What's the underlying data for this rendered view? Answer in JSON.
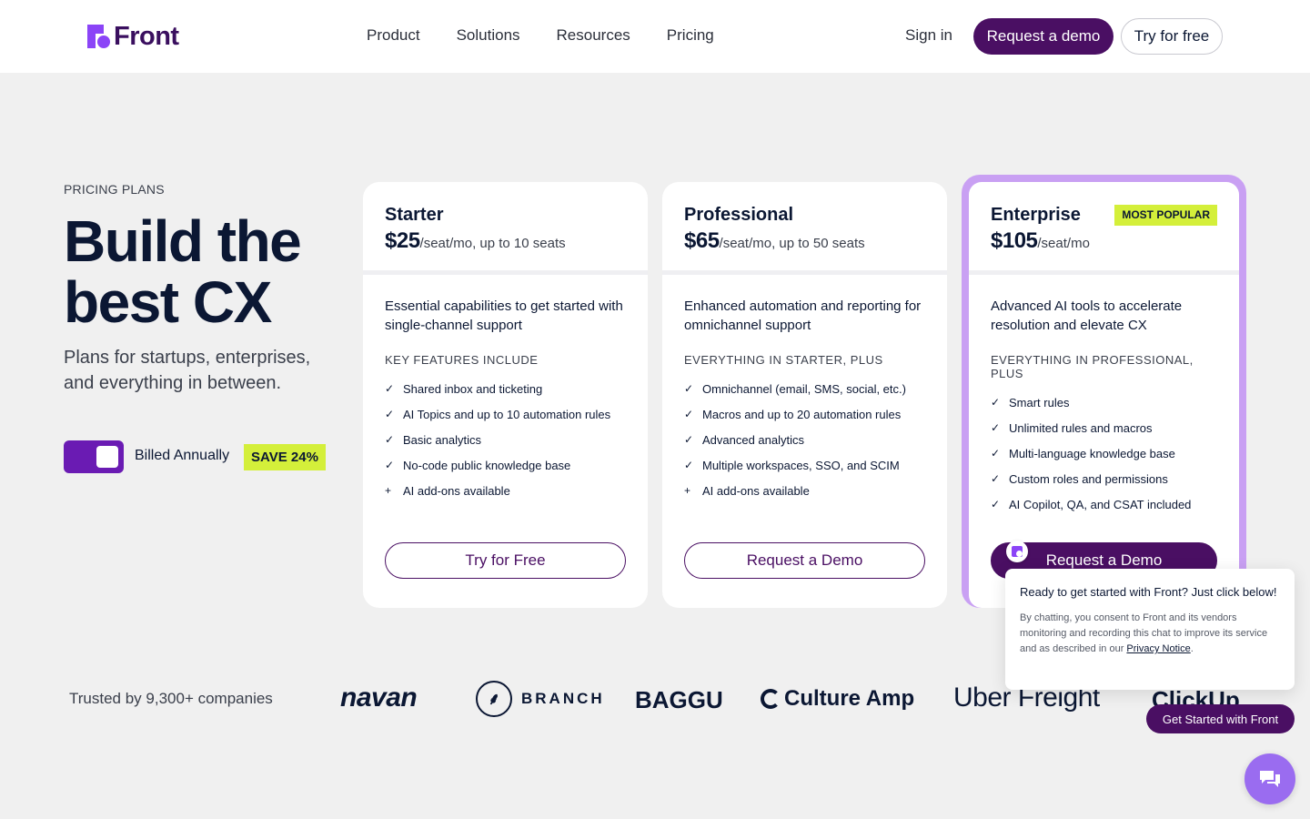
{
  "nav": {
    "logo_text": "Front",
    "links": [
      "Product",
      "Solutions",
      "Resources",
      "Pricing"
    ],
    "signin": "Sign in",
    "request_demo": "Request a demo",
    "try_free": "Try for free"
  },
  "hero": {
    "eyebrow": "PRICING PLANS",
    "headline": "Build the best CX",
    "subhead": "Plans for startups, enterprises, and everything in between.",
    "billing_label": "Billed Annually",
    "save_badge": "SAVE 24%",
    "billed_annually_on": true
  },
  "plans": [
    {
      "name": "Starter",
      "price": "$25",
      "unit": "/seat/mo, up to 10 seats",
      "badge": "",
      "description": "Essential capabilities to get started with single-channel support",
      "features_heading": "KEY FEATURES INCLUDE",
      "features": [
        {
          "icon": "check-icon",
          "text": "Shared inbox and ticketing"
        },
        {
          "icon": "check-icon",
          "text": "AI Topics and up to 10 automation rules"
        },
        {
          "icon": "check-icon",
          "text": "Basic analytics"
        },
        {
          "icon": "check-icon",
          "text": "No-code public knowledge base"
        },
        {
          "icon": "plus-icon",
          "text": "AI add-ons available"
        }
      ],
      "cta": "Try for Free"
    },
    {
      "name": "Professional",
      "price": "$65",
      "unit": "/seat/mo, up to 50 seats",
      "badge": "",
      "description": "Enhanced automation and reporting for omnichannel support",
      "features_heading": "EVERYTHING IN STARTER, PLUS",
      "features": [
        {
          "icon": "check-icon",
          "text": "Omnichannel (email, SMS, social, etc.)"
        },
        {
          "icon": "check-icon",
          "text": "Macros and up to 20 automation rules"
        },
        {
          "icon": "check-icon",
          "text": "Advanced analytics"
        },
        {
          "icon": "check-icon",
          "text": "Multiple workspaces, SSO, and SCIM"
        },
        {
          "icon": "plus-icon",
          "text": "AI add-ons available"
        }
      ],
      "cta": "Request a Demo"
    },
    {
      "name": "Enterprise",
      "price": "$105",
      "unit": "/seat/mo",
      "badge": "MOST POPULAR",
      "description": "Advanced AI tools to accelerate resolution and elevate CX",
      "features_heading": "EVERYTHING IN PROFESSIONAL, PLUS",
      "features": [
        {
          "icon": "check-icon",
          "text": "Smart rules"
        },
        {
          "icon": "check-icon",
          "text": "Unlimited rules and macros"
        },
        {
          "icon": "check-icon",
          "text": "Multi-language knowledge base"
        },
        {
          "icon": "check-icon",
          "text": "Custom roles and permissions"
        },
        {
          "icon": "check-icon",
          "text": "AI Copilot, QA, and CSAT included"
        }
      ],
      "cta": "Request a Demo"
    }
  ],
  "trusted": {
    "label": "Trusted by 9,300+ companies",
    "brands": [
      "navan",
      "BRANCH",
      "BAGGU",
      "Culture Amp",
      "Uber Freight",
      "ClickUp"
    ]
  },
  "chat": {
    "message": "Ready to get started with Front? Just click below!",
    "consent_prefix": "By chatting, you consent to Front and its vendors monitoring and recording this chat to improve its service and as described in our",
    "consent_link": "Privacy Notice",
    "consent_suffix": ".",
    "cta": "Get Started with Front"
  },
  "colors": {
    "brand_purple": "#4a0f63",
    "logo_purple": "#8b44f7",
    "highlight_lime": "#d4ef3a",
    "toggle_purple": "#6a1bb3",
    "enterprise_border": "#c9a0f3"
  }
}
